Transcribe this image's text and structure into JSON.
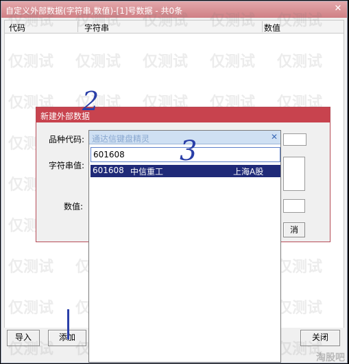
{
  "window": {
    "title": "自定义外部数据(字符串,数值)-[1]号数据 - 共0条",
    "close_glyph": "✕"
  },
  "table": {
    "columns": [
      "代码",
      "字符串",
      "数值"
    ]
  },
  "buttons": {
    "import": "导入",
    "add": "添加",
    "close": "关闭"
  },
  "dialog": {
    "title": "新建外部数据",
    "code_label": "品种代码:",
    "string_label": "字符串值:",
    "value_label": "数值:",
    "cancel_partial": "消"
  },
  "popup": {
    "title": "通达信键盘精灵",
    "close_glyph": "✕",
    "input_value": "601608",
    "results": [
      {
        "code": "601608",
        "name": "中信重工",
        "market": "上海A股"
      }
    ]
  },
  "annotations": [
    "2",
    "3"
  ],
  "watermark": {
    "text": "仅测试",
    "corner": "淘股吧"
  }
}
